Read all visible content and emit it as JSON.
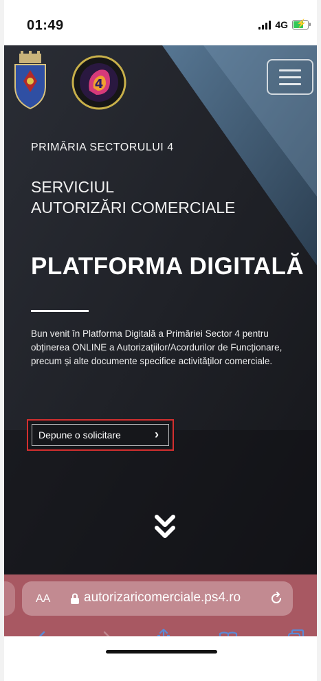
{
  "status_bar": {
    "time": "01:49",
    "network": "4G",
    "icons": [
      "signal-icon",
      "battery-charging-icon"
    ]
  },
  "header": {
    "logos": [
      "crest-logo",
      "round-emblem-logo"
    ],
    "menu_icon": "hamburger-icon"
  },
  "hero": {
    "kicker": "PRIMĂRIA SECTORULUI 4",
    "service_line1": "SERVICIUL",
    "service_line2": "AUTORIZĂRI COMERCIALE",
    "title": "PLATFORMA DIGITALĂ",
    "intro_line1": "Bun venit în Platforma Digitală a Primăriei Sector 4 pentru obținerea ONLINE a Autorizațiilor/Acordurilor de Funcționare,",
    "intro_line2": "precum și alte documente specifice activităților comerciale.",
    "cta_label": "Depune o solicitare",
    "cta_icon": "chevron-right-icon",
    "scroll_icon": "double-chevron-down-icon"
  },
  "browser": {
    "aa_label": "AA",
    "url": "autorizaricomerciale.ps4.ro",
    "toolbar_icons": [
      "back-icon",
      "forward-icon",
      "share-icon",
      "bookmarks-icon",
      "tabs-icon"
    ]
  },
  "colors": {
    "hero_bg": "#1b1d22",
    "browser_bar": "#a85862",
    "highlight_border": "#d32f2f"
  }
}
